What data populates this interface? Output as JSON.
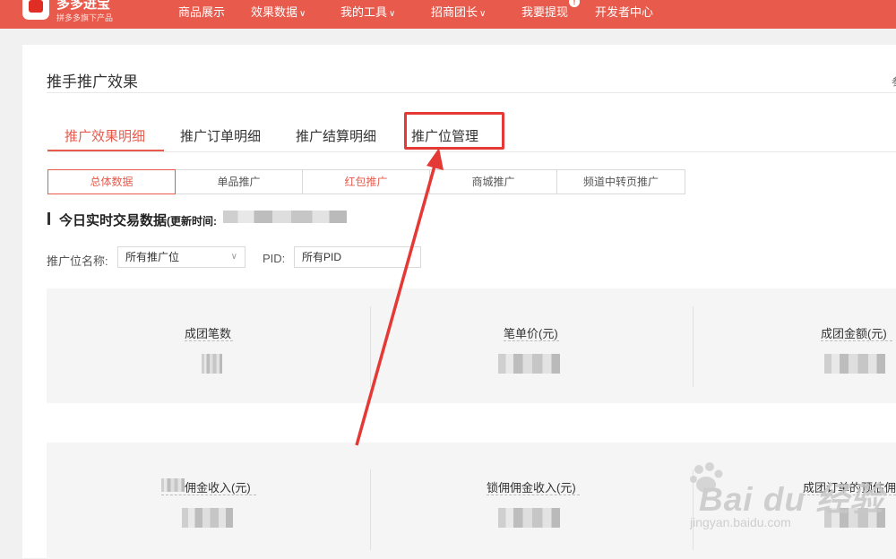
{
  "topbar": {
    "brand_title": "多多进宝",
    "brand_subtitle": "拼多多旗下产品",
    "nav": [
      {
        "label": "商品展示",
        "has_dropdown": false
      },
      {
        "label": "效果数据",
        "has_dropdown": true
      },
      {
        "label": "我的工具",
        "has_dropdown": true
      },
      {
        "label": "招商团长",
        "has_dropdown": true
      },
      {
        "label": "我要提现",
        "has_dropdown": false,
        "badge": "!"
      },
      {
        "label": "开发者中心",
        "has_dropdown": false
      }
    ],
    "color": "#e75a4c"
  },
  "page": {
    "title": "推手推广效果",
    "edge_glyph": "参"
  },
  "tabs": [
    {
      "label": "推广效果明细",
      "active": true
    },
    {
      "label": "推广订单明细",
      "active": false
    },
    {
      "label": "推广结算明细",
      "active": false
    },
    {
      "label": "推广位管理",
      "active": false,
      "highlighted": true
    }
  ],
  "segments": [
    {
      "label": "总体数据",
      "active": true
    },
    {
      "label": "单品推广",
      "active": false
    },
    {
      "label": "红包推广",
      "active": false,
      "red": true
    },
    {
      "label": "商城推广",
      "active": false
    },
    {
      "label": "频道中转页推广",
      "active": false
    }
  ],
  "section": {
    "title": "今日实时交易数据",
    "update_label": "(更新时间:"
  },
  "filters": {
    "position_label": "推广位名称:",
    "position_value": "所有推广位",
    "pid_label": "PID:",
    "pid_value": "所有PID"
  },
  "stats_row1": [
    {
      "label": "成团笔数"
    },
    {
      "label": "笔单价(元)"
    },
    {
      "label": "成团金额(元)"
    }
  ],
  "stats_row2": [
    {
      "label": "佣金收入(元)"
    },
    {
      "label": "锁佣佣金收入(元)"
    },
    {
      "label": "成团订单的预估佣金收入"
    }
  ],
  "watermark": {
    "main": "Bai du 经验",
    "sub": "jingyan.baidu.com"
  },
  "colors": {
    "accent": "#e75a4c",
    "annotation": "#e53935"
  }
}
